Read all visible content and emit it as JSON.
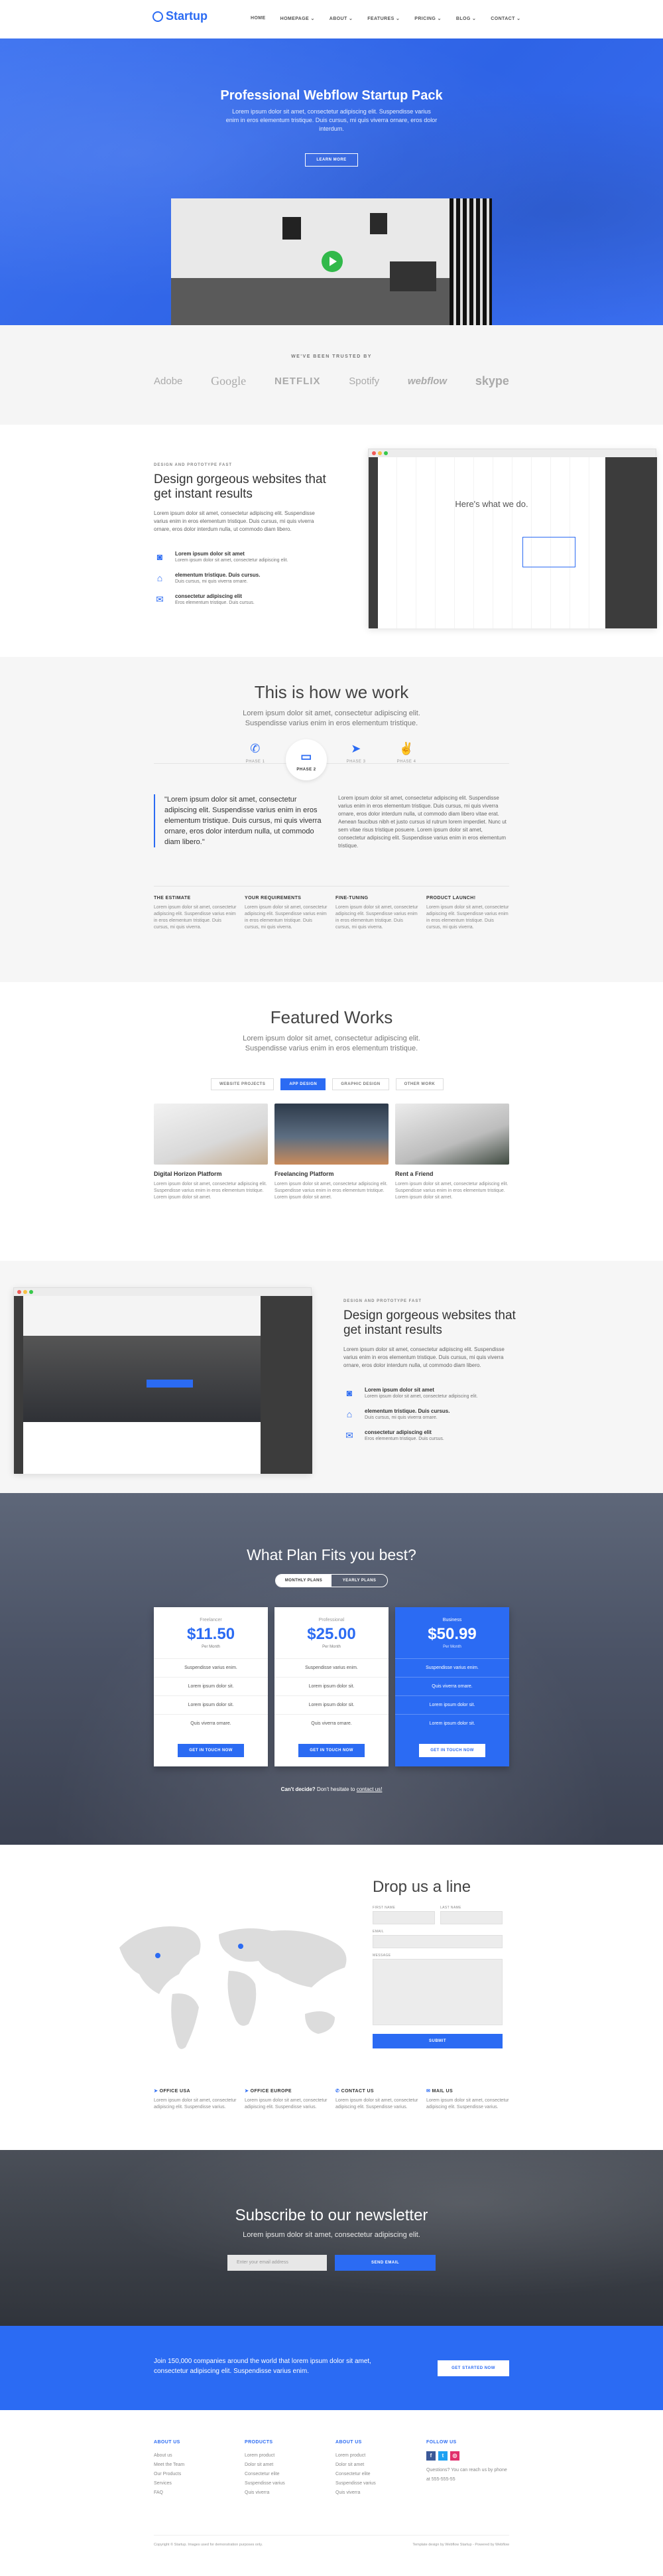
{
  "nav": {
    "logo": "Startup",
    "links": [
      "HOME",
      "HOMEPAGE ⌄",
      "ABOUT ⌄",
      "FEATURES ⌄",
      "PRICING ⌄",
      "BLOG ⌄",
      "CONTACT ⌄"
    ]
  },
  "hero": {
    "title": "Professional Webflow Startup Pack",
    "subtitle": "Lorem ipsum dolor sit amet, consectetur adipiscing elit. Suspendisse varius enim in eros elementum tristique. Duis cursus, mi quis viverra ornare, eros dolor interdum.",
    "button": "LEARN MORE"
  },
  "trusted": {
    "heading": "WE'VE BEEN TRUSTED BY",
    "logos": [
      "Adobe",
      "Google",
      "NETFLIX",
      "Spotify",
      "webflow",
      "skype"
    ]
  },
  "feature1": {
    "eyebrow": "DESIGN AND PROTOTYPE FAST",
    "title": "Design gorgeous websites that get instant results",
    "text": "Lorem ipsum dolor sit amet, consectetur adipiscing elit. Suspendisse varius enim in eros elementum tristique. Duis cursus, mi quis viverra ornare, eros dolor interdum nulla, ut commodo diam libero.",
    "items": [
      {
        "title": "Lorem ipsum dolor sit amet",
        "desc": "Lorem ipsum dolor sit amet, consectetur adipiscing elit."
      },
      {
        "title": "elementum tristique. Duis cursus.",
        "desc": "Duis cursus, mi quis viverra ornare."
      },
      {
        "title": "consectetur adipiscing elit",
        "desc": "Eros elementum tristique. Duis cursus."
      }
    ],
    "screen_heading": "Here's what we do."
  },
  "how": {
    "title": "This is how we work",
    "subtitle": "Lorem ipsum dolor sit amet, consectetur adipiscing elit. Suspendisse varius enim in eros elementum tristique.",
    "steps": [
      "PHASE 1",
      "PHASE 2",
      "PHASE 3",
      "PHASE 4"
    ],
    "quote": "\"Lorem ipsum dolor sit amet, consectetur adipiscing elit. Suspendisse varius enim in eros elementum tristique. Duis cursus, mi quis viverra ornare, eros dolor interdum nulla, ut commodo diam libero.\"",
    "paragraph": "Lorem ipsum dolor sit amet, consectetur adipiscing elit. Suspendisse varius enim in eros elementum tristique. Duis cursus, mi quis viverra ornare, eros dolor interdum nulla, ut commodo diam libero vitae erat. Aenean faucibus nibh et justo cursus id rutrum lorem imperdiet. Nunc ut sem vitae risus tristique posuere. Lorem ipsum dolor sit amet, consectetur adipiscing elit. Suspendisse varius enim in eros elementum tristique.",
    "columns": [
      {
        "title": "THE ESTIMATE",
        "text": "Lorem ipsum dolor sit amet, consectetur adipiscing elit. Suspendisse varius enim in eros elementum tristique. Duis cursus, mi quis viverra."
      },
      {
        "title": "YOUR REQUIREMENTS",
        "text": "Lorem ipsum dolor sit amet, consectetur adipiscing elit. Suspendisse varius enim in eros elementum tristique. Duis cursus, mi quis viverra."
      },
      {
        "title": "FINE-TUNING",
        "text": "Lorem ipsum dolor sit amet, consectetur adipiscing elit. Suspendisse varius enim in eros elementum tristique. Duis cursus, mi quis viverra."
      },
      {
        "title": "PRODUCT LAUNCH!",
        "text": "Lorem ipsum dolor sit amet, consectetur adipiscing elit. Suspendisse varius enim in eros elementum tristique. Duis cursus, mi quis viverra."
      }
    ]
  },
  "works": {
    "title": "Featured Works",
    "subtitle": "Lorem ipsum dolor sit amet, consectetur adipiscing elit. Suspendisse varius enim in eros elementum tristique.",
    "tabs": [
      "WEBSITE PROJECTS",
      "APP DESIGN",
      "GRAPHIC DESIGN",
      "OTHER WORK"
    ],
    "items": [
      {
        "title": "Digital Horizon Platform",
        "text": "Lorem ipsum dolor sit amet, consectetur adipiscing elit. Suspendisse varius enim in eros elementum tristique. Lorem ipsum dolor sit amet."
      },
      {
        "title": "Freelancing Platform",
        "text": "Lorem ipsum dolor sit amet, consectetur adipiscing elit. Suspendisse varius enim in eros elementum tristique. Lorem ipsum dolor sit amet."
      },
      {
        "title": "Rent a Friend",
        "text": "Lorem ipsum dolor sit amet, consectetur adipiscing elit. Suspendisse varius enim in eros elementum tristique. Lorem ipsum dolor sit amet."
      }
    ]
  },
  "feature2": {
    "eyebrow": "DESIGN AND PROTOTYPE FAST",
    "title": "Design gorgeous websites that get instant results",
    "text": "Lorem ipsum dolor sit amet, consectetur adipiscing elit. Suspendisse varius enim in eros elementum tristique. Duis cursus, mi quis viverra ornare, eros dolor interdum nulla, ut commodo diam libero.",
    "items": [
      {
        "title": "Lorem ipsum dolor sit amet",
        "desc": "Lorem ipsum dolor sit amet, consectetur adipiscing elit."
      },
      {
        "title": "elementum tristique. Duis cursus.",
        "desc": "Duis cursus, mi quis viverra ornare."
      },
      {
        "title": "consectetur adipiscing elit",
        "desc": "Eros elementum tristique. Duis cursus."
      }
    ]
  },
  "pricing": {
    "title": "What Plan Fits you best?",
    "toggle": [
      "MONTHLY PLANS",
      "YEARLY PLANS"
    ],
    "plans": [
      {
        "name": "Freelancer",
        "price": "$11.50",
        "period": "Per Month",
        "features": [
          "Suspendisse varius enim.",
          "Lorem ipsum dolor sit.",
          "Lorem ipsum dolor sit.",
          "Quis viverra ornare.",
          "Suspendisse varius enim."
        ],
        "button": "GET IN TOUCH NOW"
      },
      {
        "name": "Professional",
        "price": "$25.00",
        "period": "Per Month",
        "features": [
          "Suspendisse varius enim.",
          "Lorem ipsum dolor sit.",
          "Lorem ipsum dolor sit.",
          "Quis viverra ornare.",
          "Suspendisse varius enim."
        ],
        "button": "GET IN TOUCH NOW"
      },
      {
        "name": "Business",
        "price": "$50.99",
        "period": "Per Month",
        "features": [
          "Suspendisse varius enim.",
          "Quis viverra ornare.",
          "Lorem ipsum dolor sit.",
          "Lorem ipsum dolor sit.",
          "Suspendisse varius enim."
        ],
        "button": "GET IN TOUCH NOW"
      }
    ],
    "note_bold": "Can't decide?",
    "note_text": "Don't hesitate to",
    "note_link": "contact us!"
  },
  "contact": {
    "title": "Drop us a line",
    "labels": [
      "FIRST NAME",
      "LAST NAME",
      "EMAIL",
      "MESSAGE"
    ],
    "submit": "SUBMIT",
    "offices": [
      {
        "title": "OFFICE USA",
        "text": "Lorem ipsum dolor sit amet, consectetur adipiscing elit. Suspendisse varius."
      },
      {
        "title": "OFFICE EUROPE",
        "text": "Lorem ipsum dolor sit amet, consectetur adipiscing elit. Suspendisse varius."
      },
      {
        "title": "CONTACT US",
        "text": "Lorem ipsum dolor sit amet, consectetur adipiscing elit. Suspendisse varius."
      },
      {
        "title": "MAIL US",
        "text": "Lorem ipsum dolor sit amet, consectetur adipiscing elit. Suspendisse varius."
      }
    ]
  },
  "newsletter": {
    "title": "Subscribe to our newsletter",
    "subtitle": "Lorem ipsum dolor sit amet, consectetur adipiscing elit.",
    "placeholder": "Enter your email address",
    "button": "SEND EMAIL"
  },
  "cta": {
    "text": "Join 150,000 companies around the world that lorem ipsum dolor sit amet, consectetur adipiscing elit. Suspendisse varius enim.",
    "button": "GET STARTED NOW"
  },
  "footer": {
    "columns": [
      {
        "title": "ABOUT US",
        "links": [
          "About us",
          "Meet the Team",
          "Our Products",
          "Services",
          "FAQ"
        ]
      },
      {
        "title": "PRODUCTS",
        "links": [
          "Lorem product",
          "Dolor sit amet",
          "Consectetur elite",
          "Suspendisse varius",
          "Quis viverra"
        ]
      },
      {
        "title": "ABOUT US",
        "links": [
          "Lorem product",
          "Dolor sit amet",
          "Consectetur elite",
          "Suspendisse varius",
          "Quis viverra"
        ]
      },
      {
        "title": "FOLLOW US",
        "links": [
          "Questions? You can reach us by phone at 555-555-55"
        ]
      }
    ],
    "copyright": "Copyright © Startup. Images used for demonstration purposes only.",
    "credit": "Template design by Webflow Startup - Powered by Webflow"
  },
  "colors": {
    "accent": "#2b6bf3",
    "green": "#31b94a",
    "dark": "#333333"
  }
}
